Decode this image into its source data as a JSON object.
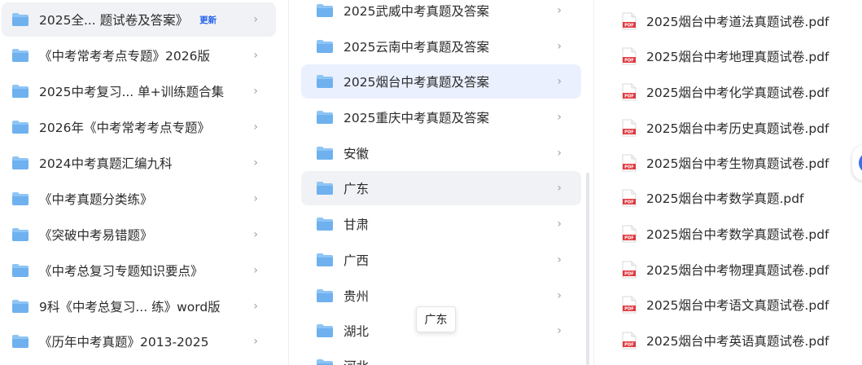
{
  "column1": {
    "items": [
      {
        "label": "2025全...  题试卷及答案》",
        "badge": "更新"
      },
      {
        "label": "《中考常考考点专题》2026版"
      },
      {
        "label": "2025中考复习... 单+训练题合集"
      },
      {
        "label": "2026年《中考常考考点专题》"
      },
      {
        "label": "2024中考真题汇编九科"
      },
      {
        "label": "《中考真题分类练》"
      },
      {
        "label": "《突破中考易错题》"
      },
      {
        "label": "《中考总复习专题知识要点》"
      },
      {
        "label": "9科《中考总复习...  练》word版"
      },
      {
        "label": "《历年中考真题》2013-2025"
      }
    ]
  },
  "column2": {
    "items": [
      {
        "label": "2025武威中考真题及答案"
      },
      {
        "label": "2025云南中考真题及答案"
      },
      {
        "label": "2025烟台中考真题及答案"
      },
      {
        "label": "2025重庆中考真题及答案"
      },
      {
        "label": "安徽"
      },
      {
        "label": "广东"
      },
      {
        "label": "甘肃"
      },
      {
        "label": "广西"
      },
      {
        "label": "贵州"
      },
      {
        "label": "湖北"
      },
      {
        "label": "河北"
      }
    ]
  },
  "column3": {
    "items": [
      {
        "label": "2025烟台中考道法真题试卷.pdf"
      },
      {
        "label": "2025烟台中考地理真题试卷.pdf"
      },
      {
        "label": "2025烟台中考化学真题试卷.pdf"
      },
      {
        "label": "2025烟台中考历史真题试卷.pdf"
      },
      {
        "label": "2025烟台中考生物真题试卷.pdf"
      },
      {
        "label": "2025烟台中考数学真题.pdf"
      },
      {
        "label": "2025烟台中考数学真题试卷.pdf"
      },
      {
        "label": "2025烟台中考物理真题试卷.pdf"
      },
      {
        "label": "2025烟台中考语文真题试卷.pdf"
      },
      {
        "label": "2025烟台中考英语真题试卷.pdf"
      }
    ]
  },
  "tooltip": {
    "text": "广东"
  },
  "icons": {
    "folder": "folder-icon",
    "pdf": "pdf-file-icon",
    "chevron": "chevron-right-icon"
  },
  "colors": {
    "folder": "#8ec5f5",
    "pdf": "#e0393e",
    "accent": "#2563eb"
  }
}
